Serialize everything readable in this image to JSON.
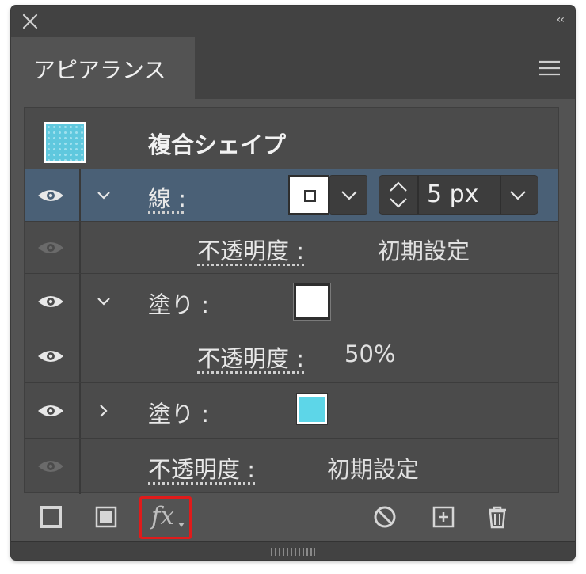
{
  "panel": {
    "tab_label": "アピアランス",
    "collapse_label": "‹‹"
  },
  "header": {
    "object_title": "複合シェイプ"
  },
  "rows": [
    {
      "label": "線 :",
      "stroke_weight": "5 px"
    },
    {
      "label": "不透明度 :",
      "value": "初期設定"
    },
    {
      "label": "塗り :"
    },
    {
      "label": "不透明度 :",
      "value": "50%"
    },
    {
      "label": "塗り :"
    },
    {
      "label": "不透明度 :",
      "value": "初期設定"
    }
  ],
  "colors": {
    "panel_bg": "#535353",
    "selected_row": "#4a6076",
    "fill_cyan": "#5dd6e8",
    "fx_highlight": "#e01b1b"
  },
  "bottom_toolbar": {
    "fx_label": "fx"
  }
}
